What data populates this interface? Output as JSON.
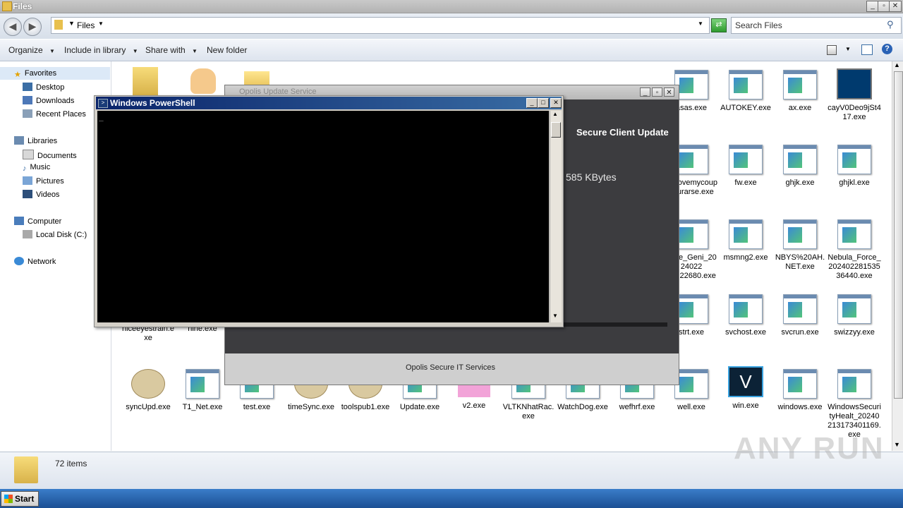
{
  "window": {
    "title": "Files"
  },
  "address": {
    "breadcrumb": "Files",
    "search_placeholder": "Search Files"
  },
  "toolbar": {
    "organize": "Organize",
    "include_library": "Include in library",
    "share_with": "Share with",
    "new_folder": "New folder"
  },
  "nav": {
    "favorites": "Favorites",
    "favorites_items": [
      "Desktop",
      "Downloads",
      "Recent Places"
    ],
    "libraries": "Libraries",
    "libraries_items": [
      "Documents",
      "Music",
      "Pictures",
      "Videos"
    ],
    "computer": "Computer",
    "computer_items": [
      "Local Disk (C:)"
    ],
    "network": "Network"
  },
  "files": {
    "row1": [
      "asas.exe",
      "AUTOKEY.exe",
      "ax.exe",
      "cayV0Deo9jSt417.exe"
    ],
    "row2": [
      "_shovemycoupyourarse.exe",
      "fw.exe",
      "ghjk.exe",
      "ghjkl.exe"
    ],
    "row3": [
      "racle_Geni_2024022 10322680.exe",
      "msmng2.exe",
      "NBYS%20AH.NET.exe",
      "Nebula_Force_20240228153536440.exe"
    ],
    "row4": [
      "niceeyestrain.exe",
      "nine.exe",
      "strt.exe",
      "svchost.exe",
      "svcrun.exe",
      "swizzyy.exe"
    ],
    "row5": [
      "syncUpd.exe",
      "T1_Net.exe",
      "test.exe",
      "timeSync.exe",
      "toolspub1.exe",
      "Update.exe",
      "v2.exe",
      "VLTKNhatRac.exe",
      "WatchDog.exe",
      "wefhrf.exe",
      "well.exe",
      "win.exe",
      "windows.exe",
      "WindowsSecurityHealt_20240213173401169.exe"
    ]
  },
  "details": {
    "count": "72 items"
  },
  "opolis": {
    "title": "Opolis Update Service",
    "heading": "Secure Client Update",
    "size": "585 KBytes",
    "footer": "Opolis Secure IT Services"
  },
  "powershell": {
    "title": "Windows PowerShell",
    "cursor": "_"
  },
  "taskbar": {
    "start": "Start"
  },
  "watermark": "ANY RUN"
}
